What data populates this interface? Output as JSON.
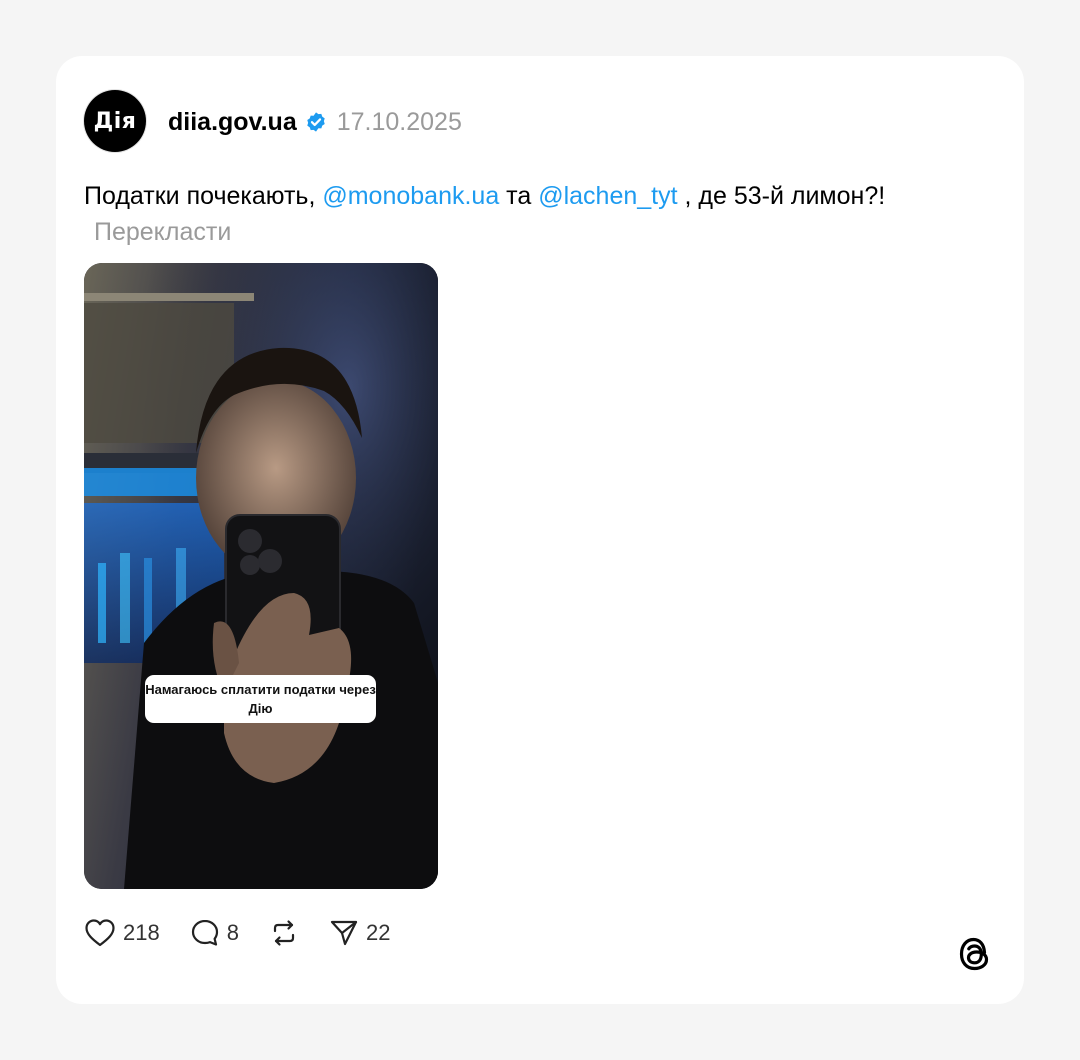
{
  "post": {
    "avatar_text": "Дія",
    "username": "diia.gov.ua",
    "date": "17.10.2025",
    "text_part1": "Податки почекають, ",
    "mention1": "@monobank.ua",
    "text_part2": " та ",
    "mention2": "@lachen_tyt",
    "text_part3": " , де 53-й лимон?!",
    "translate_label": "Перекласти",
    "media_caption": "Намагаюсь сплатити податки через Дію"
  },
  "actions": {
    "likes": "218",
    "comments": "8",
    "shares": "22"
  },
  "icons": {
    "verified": "verified-badge-icon",
    "like": "heart-icon",
    "comment": "comment-bubble-icon",
    "repost": "repost-icon",
    "share": "paper-plane-icon",
    "brand": "threads-logo-icon"
  },
  "colors": {
    "mention": "#1d9bf0",
    "verified": "#1d9bf0",
    "secondary_text": "#9a9a9a"
  }
}
